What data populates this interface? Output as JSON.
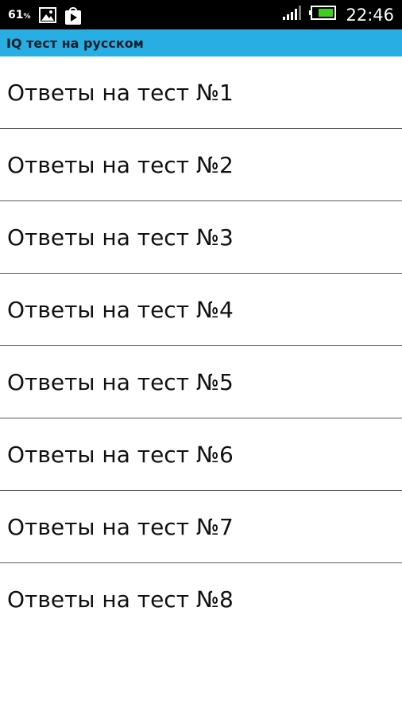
{
  "status_bar": {
    "battery_percent": "61",
    "battery_percent_unit": "%",
    "time": "22:46",
    "icons": [
      "gallery-icon",
      "play-store-icon",
      "signal-icon",
      "battery-icon"
    ],
    "battery_color": "#3fcf1f"
  },
  "app_bar": {
    "title": "IQ тест на русском",
    "color": "#29aee3"
  },
  "list": {
    "items": [
      {
        "label": "Ответы на тест №1"
      },
      {
        "label": "Ответы на тест №2"
      },
      {
        "label": "Ответы на тест №3"
      },
      {
        "label": "Ответы на тест №4"
      },
      {
        "label": "Ответы на тест №5"
      },
      {
        "label": "Ответы на тест №6"
      },
      {
        "label": "Ответы на тест №7"
      },
      {
        "label": "Ответы на тест №8"
      }
    ]
  }
}
